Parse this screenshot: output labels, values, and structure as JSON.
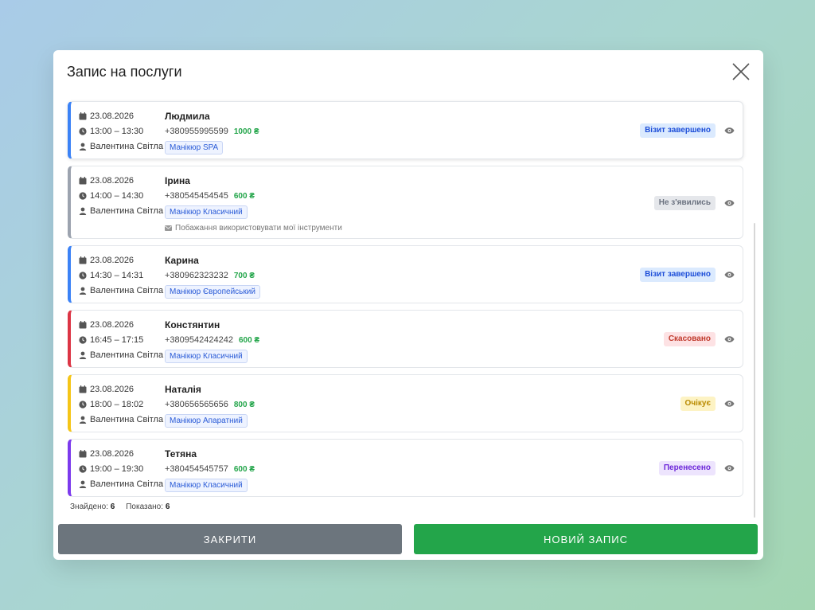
{
  "modal": {
    "title": "Запис на послуги"
  },
  "appointments": [
    {
      "date": "23.08.2026",
      "time": "13:00 – 13:30",
      "master": "Валентина Світла",
      "client": "Людмила",
      "phone": "+380955995599",
      "price": "1000 ₴",
      "service": "Манікюр SPA",
      "note": "",
      "status": "Візит завершено",
      "accent": "#3b82f6",
      "status_bg": "#dbeafe",
      "status_fg": "#1d4ed8"
    },
    {
      "date": "23.08.2026",
      "time": "14:00 – 14:30",
      "master": "Валентина Світла",
      "client": "Ірина",
      "phone": "+380545454545",
      "price": "600 ₴",
      "service": "Манікюр Класичний",
      "note": "Побажання використовувати мої інструменти",
      "status": "Не з'явились",
      "accent": "#9ca3af",
      "status_bg": "#e5e7eb",
      "status_fg": "#6b7280"
    },
    {
      "date": "23.08.2026",
      "time": "14:30 – 14:31",
      "master": "Валентина Світла",
      "client": "Карина",
      "phone": "+380962323232",
      "price": "700 ₴",
      "service": "Манікюр Європейський",
      "note": "",
      "status": "Візит завершено",
      "accent": "#3b82f6",
      "status_bg": "#dbeafe",
      "status_fg": "#1d4ed8"
    },
    {
      "date": "23.08.2026",
      "time": "16:45 – 17:15",
      "master": "Валентина Світла",
      "client": "Констянтин",
      "phone": "+3809542424242",
      "price": "600 ₴",
      "service": "Манікюр Класичний",
      "note": "",
      "status": "Скасовано",
      "accent": "#dc3545",
      "status_bg": "#fde2e4",
      "status_fg": "#c0392b"
    },
    {
      "date": "23.08.2026",
      "time": "18:00 – 18:02",
      "master": "Валентина Світла",
      "client": "Наталія",
      "phone": "+380656565656",
      "price": "800 ₴",
      "service": "Манікюр Апаратний",
      "note": "",
      "status": "Очікує",
      "accent": "#f5c518",
      "status_bg": "#fdf3c4",
      "status_fg": "#b98a00"
    },
    {
      "date": "23.08.2026",
      "time": "19:00 – 19:30",
      "master": "Валентина Світла",
      "client": "Тетяна",
      "phone": "+380454545757",
      "price": "600 ₴",
      "service": "Манікюр Класичний",
      "note": "",
      "status": "Перенесено",
      "accent": "#7c3aed",
      "status_bg": "#ede4fd",
      "status_fg": "#6d28d9"
    }
  ],
  "footer": {
    "found_label": "Знайдено:",
    "found_value": "6",
    "shown_label": "Показано:",
    "shown_value": "6"
  },
  "buttons": {
    "close_label": "ЗАКРИТИ",
    "new_label": "НОВИЙ ЗАПИС"
  },
  "icons": {
    "date": "calendar-icon",
    "time": "clock-icon",
    "master": "user-icon",
    "note": "envelope-icon",
    "view": "eye-icon",
    "close": "close-icon"
  }
}
